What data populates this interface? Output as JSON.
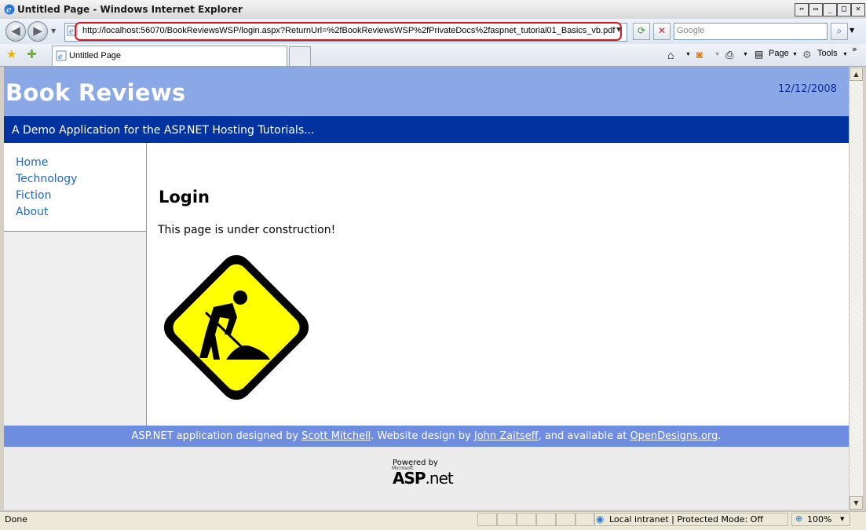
{
  "window": {
    "title": "Untitled Page - Windows Internet Explorer"
  },
  "address_bar": {
    "url": "http://localhost:56070/BookReviewsWSP/login.aspx?ReturnUrl=%2fBookReviewsWSP%2fPrivateDocs%2faspnet_tutorial01_Basics_vb.pdf"
  },
  "search": {
    "placeholder": "Google"
  },
  "tabs": [
    {
      "label": "Untitled Page"
    }
  ],
  "command_bar": {
    "page_label": "Page",
    "tools_label": "Tools"
  },
  "page": {
    "site_title": "Book Reviews",
    "date": "12/12/2008",
    "subtitle": "A Demo Application for the ASP.NET Hosting Tutorials...",
    "menu": [
      {
        "label": "Home"
      },
      {
        "label": "Technology"
      },
      {
        "label": "Fiction"
      },
      {
        "label": "About"
      }
    ],
    "heading": "Login",
    "body_text": "This page is under construction!",
    "footer": {
      "prefix": "ASP.NET application designed by ",
      "link1": "Scott Mitchell",
      "middle": ". Website design by ",
      "link2": "John Zaitseff",
      "middle2": ", and available at ",
      "link3": "OpenDesigns.org",
      "suffix": "."
    },
    "powered_by": "Powered by",
    "microsoft": "Microsoft",
    "aspnet_bold": "ASP",
    "aspnet_rest": ".net"
  },
  "status_bar": {
    "status": "Done",
    "zone": "Local intranet | Protected Mode: Off",
    "zoom": "100%"
  },
  "colors": {
    "header": "#8ba8e6",
    "subbar": "#0033a0",
    "footer": "#6f8de0",
    "link": "#1f66c4",
    "sign_yellow": "#ffff00"
  }
}
